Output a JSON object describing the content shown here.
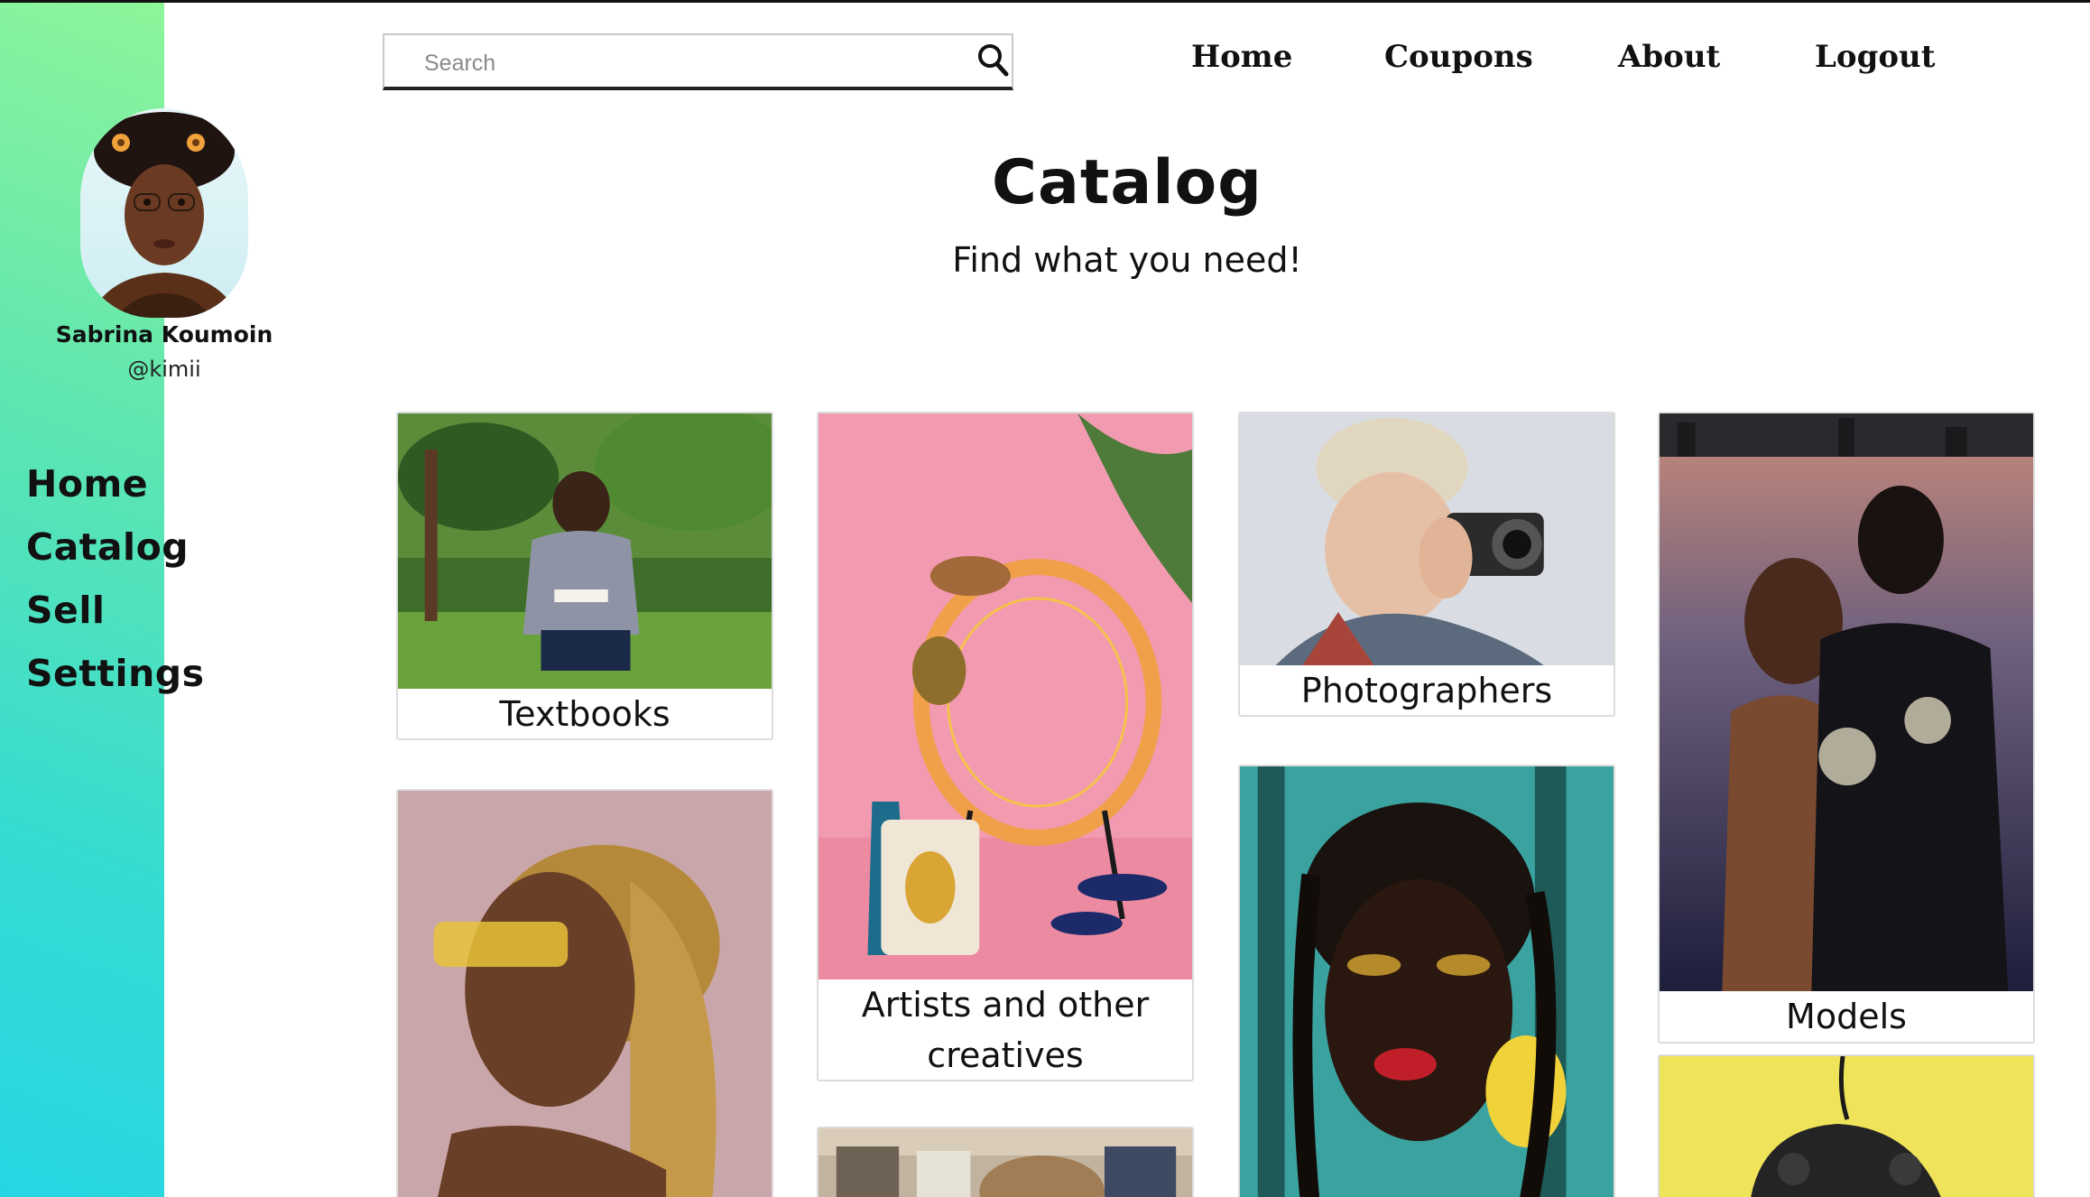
{
  "profile": {
    "name": "Sabrina Koumoin",
    "handle": "@kimii"
  },
  "sidebar": {
    "items": [
      {
        "label": "Home"
      },
      {
        "label": "Catalog"
      },
      {
        "label": "Sell"
      },
      {
        "label": "Settings"
      }
    ]
  },
  "search": {
    "placeholder": "Search",
    "value": ""
  },
  "topnav": {
    "items": [
      {
        "label": "Home"
      },
      {
        "label": "Coupons"
      },
      {
        "label": "About"
      },
      {
        "label": "Logout"
      }
    ]
  },
  "main": {
    "title": "Catalog",
    "subtitle": "Find what you need!"
  },
  "catalog": {
    "cards": [
      {
        "caption": "Textbooks",
        "icon": "textbooks-photo"
      },
      {
        "caption": "Artists and other creatives",
        "icon": "artists-photo"
      },
      {
        "caption": "Photographers",
        "icon": "photographers-photo"
      },
      {
        "caption": "Models",
        "icon": "models-photo"
      },
      {
        "caption": "",
        "icon": "hair-photo"
      },
      {
        "caption": "",
        "icon": "clothing-photo"
      },
      {
        "caption": "",
        "icon": "makeup-photo"
      },
      {
        "caption": "",
        "icon": "gaming-photo"
      }
    ]
  },
  "colors": {
    "sidebar_gradient_top": "#8ef59a",
    "sidebar_gradient_bottom": "#25d6e3",
    "text": "#111111"
  }
}
